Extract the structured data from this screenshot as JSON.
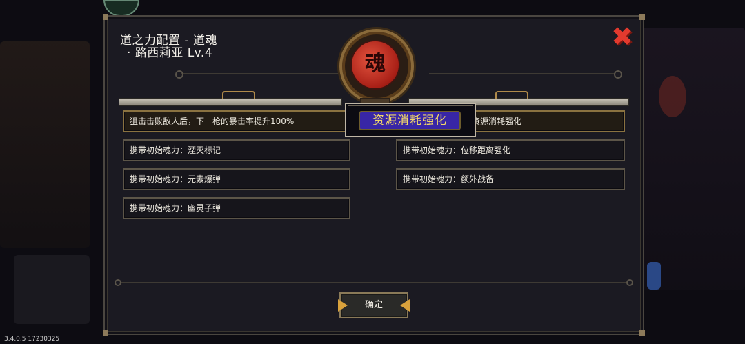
{
  "version_label": "3.4.0.5 17230325",
  "dialog": {
    "title_line1": "道之力配置 - 道魂",
    "title_line2": "· 路西莉亚 Lv.4",
    "close_glyph": "✖",
    "medallion_glyph": "魂",
    "tooltip_label": "资源消耗强化",
    "left_rows": [
      "狙击击败敌人后，下一枪的暴击率提升100%",
      "携带初始魂力：湮灭标记",
      "携带初始魂力：元素爆弹",
      "携带初始魂力：幽灵子弹"
    ],
    "right_rows": [
      "资源消耗强化",
      "携带初始魂力：位移距离强化",
      "携带初始魂力：额外战备"
    ],
    "confirm_label": "确定"
  },
  "colors": {
    "accent_gold": "#d9a23c",
    "close_red": "#e33a2e",
    "tooltip_blue": "#3826a6",
    "tooltip_text": "#f0d66a"
  }
}
